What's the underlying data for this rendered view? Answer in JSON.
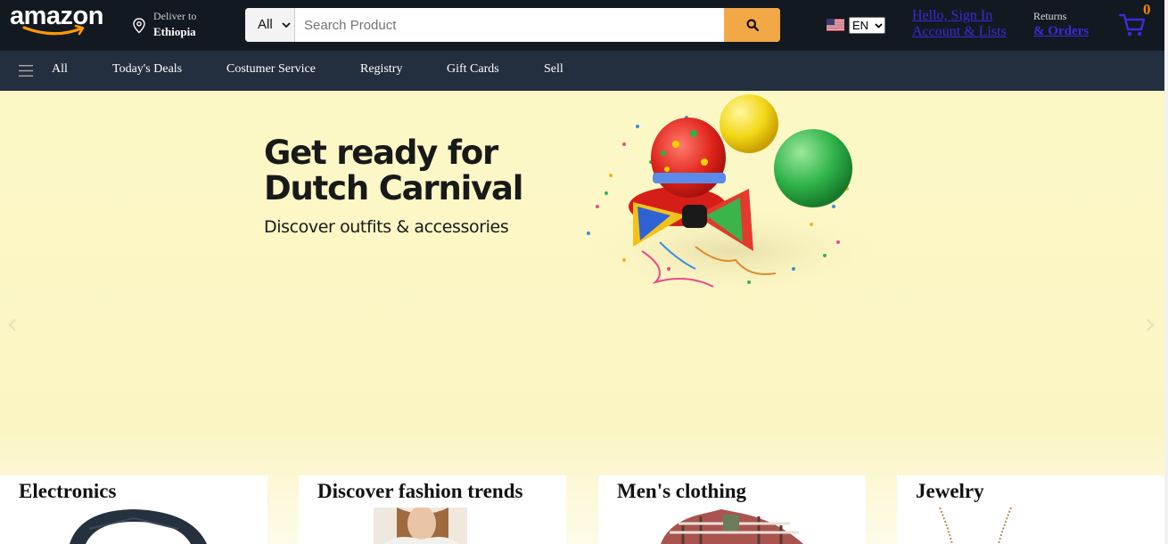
{
  "header": {
    "logo_text": "amazon",
    "deliver": {
      "line1": "Deliver to",
      "line2": "Ethiopia"
    },
    "search": {
      "category": "All",
      "placeholder": "Search Product"
    },
    "language": "EN",
    "account": {
      "line1": "Hello, Sign In",
      "line2": "Account & Lists"
    },
    "orders": {
      "line1": "Returns",
      "line2": "& Orders"
    },
    "cart_count": "0"
  },
  "nav": {
    "all_label": "All",
    "items": [
      "Today's Deals",
      "Costumer Service",
      "Registry",
      "Gift Cards",
      "Sell"
    ]
  },
  "hero": {
    "title": "Get ready for Dutch Carnival",
    "subtitle": "Discover outfits & accessories"
  },
  "cards": [
    {
      "title": "Electronics"
    },
    {
      "title": "Discover fashion trends"
    },
    {
      "title": "Men's clothing"
    },
    {
      "title": "Jewelry"
    }
  ],
  "colors": {
    "header_bg": "#131921",
    "nav_bg": "#232f3e",
    "search_button": "#f3a847",
    "hero_bg": "#fcf8c6",
    "cart_count": "#f08804",
    "link": "#3b2bd9"
  },
  "icons": {
    "location": "map-pin-icon",
    "search": "magnifier-icon",
    "cart": "shopping-cart-icon",
    "menu": "hamburger-icon",
    "flag": "us-flag-icon"
  }
}
